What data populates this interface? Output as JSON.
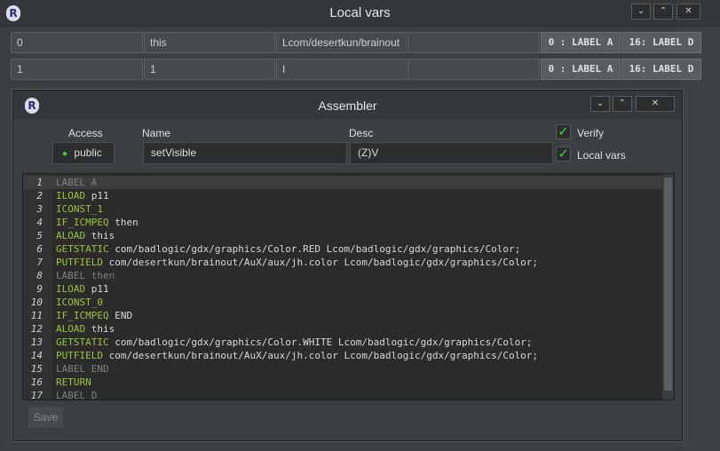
{
  "window": {
    "title": "Local vars",
    "logo_letter": "R",
    "buttons": {
      "minimize": "⌄",
      "maximize": "⌃",
      "close": "✕"
    }
  },
  "local_vars": [
    {
      "index": "0",
      "name": "this",
      "desc": "Lcom/desertkun/brainout",
      "signature": "",
      "start": "0 : LABEL A",
      "end": "16: LABEL D"
    },
    {
      "index": "1",
      "name": "1",
      "desc": "I",
      "signature": "",
      "start": "0 : LABEL A",
      "end": "16: LABEL D"
    }
  ],
  "assembler": {
    "title": "Assembler",
    "logo_letter": "R",
    "buttons": {
      "minimize": "⌄",
      "maximize": "⌃",
      "close": "✕"
    },
    "access_label": "Access",
    "access_value": "public",
    "name_label": "Name",
    "name_value": "setVisible",
    "desc_label": "Desc",
    "desc_value": "(Z)V",
    "verify_label": "Verify",
    "localvars_label": "Local vars",
    "check_mark": "✓",
    "save_label": "Save",
    "code": [
      {
        "n": "1",
        "op": "LABEL A",
        "arg": "",
        "kind": "label"
      },
      {
        "n": "2",
        "op": "ILOAD",
        "arg": " p11",
        "kind": "insn"
      },
      {
        "n": "3",
        "op": "ICONST_1",
        "arg": "",
        "kind": "insn"
      },
      {
        "n": "4",
        "op": "IF_ICMPEQ",
        "arg": " then",
        "kind": "insn"
      },
      {
        "n": "5",
        "op": "ALOAD",
        "arg": " this",
        "kind": "insn"
      },
      {
        "n": "6",
        "op": "GETSTATIC",
        "arg": " com/badlogic/gdx/graphics/Color.RED Lcom/badlogic/gdx/graphics/Color;",
        "kind": "insn"
      },
      {
        "n": "7",
        "op": "PUTFIELD",
        "arg": " com/desertkun/brainout/AuX/aux/jh.color Lcom/badlogic/gdx/graphics/Color;",
        "kind": "insn"
      },
      {
        "n": "8",
        "op": "LABEL then",
        "arg": "",
        "kind": "label"
      },
      {
        "n": "9",
        "op": "ILOAD",
        "arg": " p11",
        "kind": "insn"
      },
      {
        "n": "10",
        "op": "ICONST_0",
        "arg": "",
        "kind": "insn"
      },
      {
        "n": "11",
        "op": "IF_ICMPEQ",
        "arg": " END",
        "kind": "insn"
      },
      {
        "n": "12",
        "op": "ALOAD",
        "arg": " this",
        "kind": "insn"
      },
      {
        "n": "13",
        "op": "GETSTATIC",
        "arg": " com/badlogic/gdx/graphics/Color.WHITE Lcom/badlogic/gdx/graphics/Color;",
        "kind": "insn"
      },
      {
        "n": "14",
        "op": "PUTFIELD",
        "arg": " com/desertkun/brainout/AuX/aux/jh.color Lcom/badlogic/gdx/graphics/Color;",
        "kind": "insn"
      },
      {
        "n": "15",
        "op": "LABEL END",
        "arg": "",
        "kind": "label"
      },
      {
        "n": "16",
        "op": "RETURN",
        "arg": "",
        "kind": "insn"
      },
      {
        "n": "17",
        "op": "LABEL D",
        "arg": "",
        "kind": "label"
      }
    ]
  },
  "colors": {
    "opcode": "#9cc23a",
    "label": "#808080",
    "check": "#3bd93b"
  }
}
